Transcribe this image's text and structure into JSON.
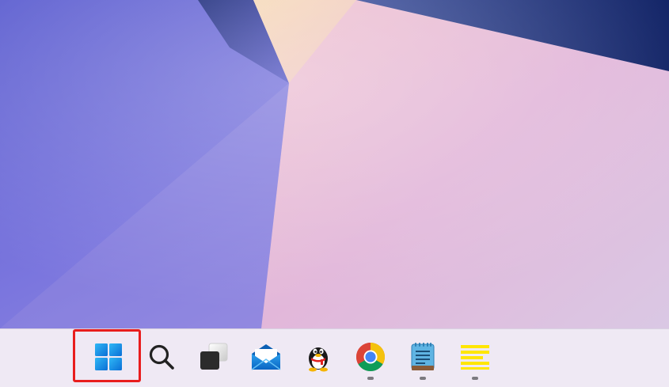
{
  "desktop": {
    "wallpaper": "windows-11-bloom-light"
  },
  "taskbar": {
    "background": "#efe9f4",
    "highlight_color": "#e81d1d",
    "items": [
      {
        "name": "start",
        "icon": "windows-logo-icon",
        "running": false,
        "highlighted": true
      },
      {
        "name": "search",
        "icon": "search-icon",
        "running": false
      },
      {
        "name": "task-view",
        "icon": "task-view-icon",
        "running": false
      },
      {
        "name": "mail",
        "icon": "mail-envelope-icon",
        "running": false
      },
      {
        "name": "qq",
        "icon": "qq-penguin-icon",
        "running": false
      },
      {
        "name": "chrome",
        "icon": "chrome-icon",
        "running": true
      },
      {
        "name": "notepad",
        "icon": "notepad-icon",
        "running": true
      },
      {
        "name": "sticky-notes",
        "icon": "sticky-notes-icon",
        "running": true
      }
    ]
  }
}
